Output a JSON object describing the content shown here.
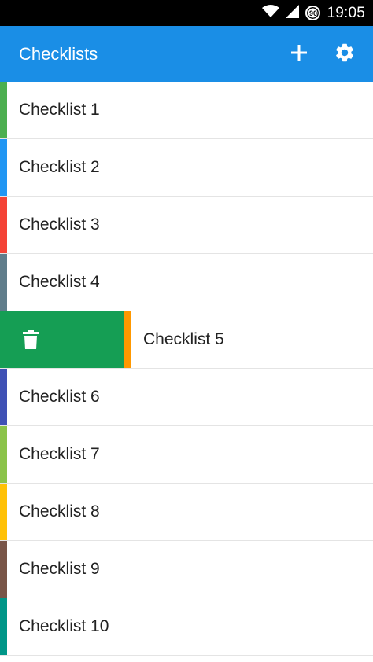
{
  "status_bar": {
    "time": "19:05",
    "battery_level": "90"
  },
  "app_bar": {
    "title": "Checklists",
    "add_icon": "plus-icon",
    "settings_icon": "gear-icon"
  },
  "delete_action": {
    "icon": "trash-icon",
    "color": "#159e54"
  },
  "checklists": [
    {
      "label": "Checklist 1",
      "color": "#4caf50",
      "swiped": false
    },
    {
      "label": "Checklist 2",
      "color": "#2196f3",
      "swiped": false
    },
    {
      "label": "Checklist 3",
      "color": "#f44336",
      "swiped": false
    },
    {
      "label": "Checklist 4",
      "color": "#607d8b",
      "swiped": false
    },
    {
      "label": "Checklist 5",
      "color": "#ff9800",
      "swiped": true
    },
    {
      "label": "Checklist 6",
      "color": "#3f51b5",
      "swiped": false
    },
    {
      "label": "Checklist 7",
      "color": "#8bc34a",
      "swiped": false
    },
    {
      "label": "Checklist 8",
      "color": "#ffc107",
      "swiped": false
    },
    {
      "label": "Checklist 9",
      "color": "#795548",
      "swiped": false
    },
    {
      "label": "Checklist 10",
      "color": "#009688",
      "swiped": false
    }
  ],
  "colors": {
    "app_bar": "#1a8ee6",
    "status_bar": "#000000"
  }
}
